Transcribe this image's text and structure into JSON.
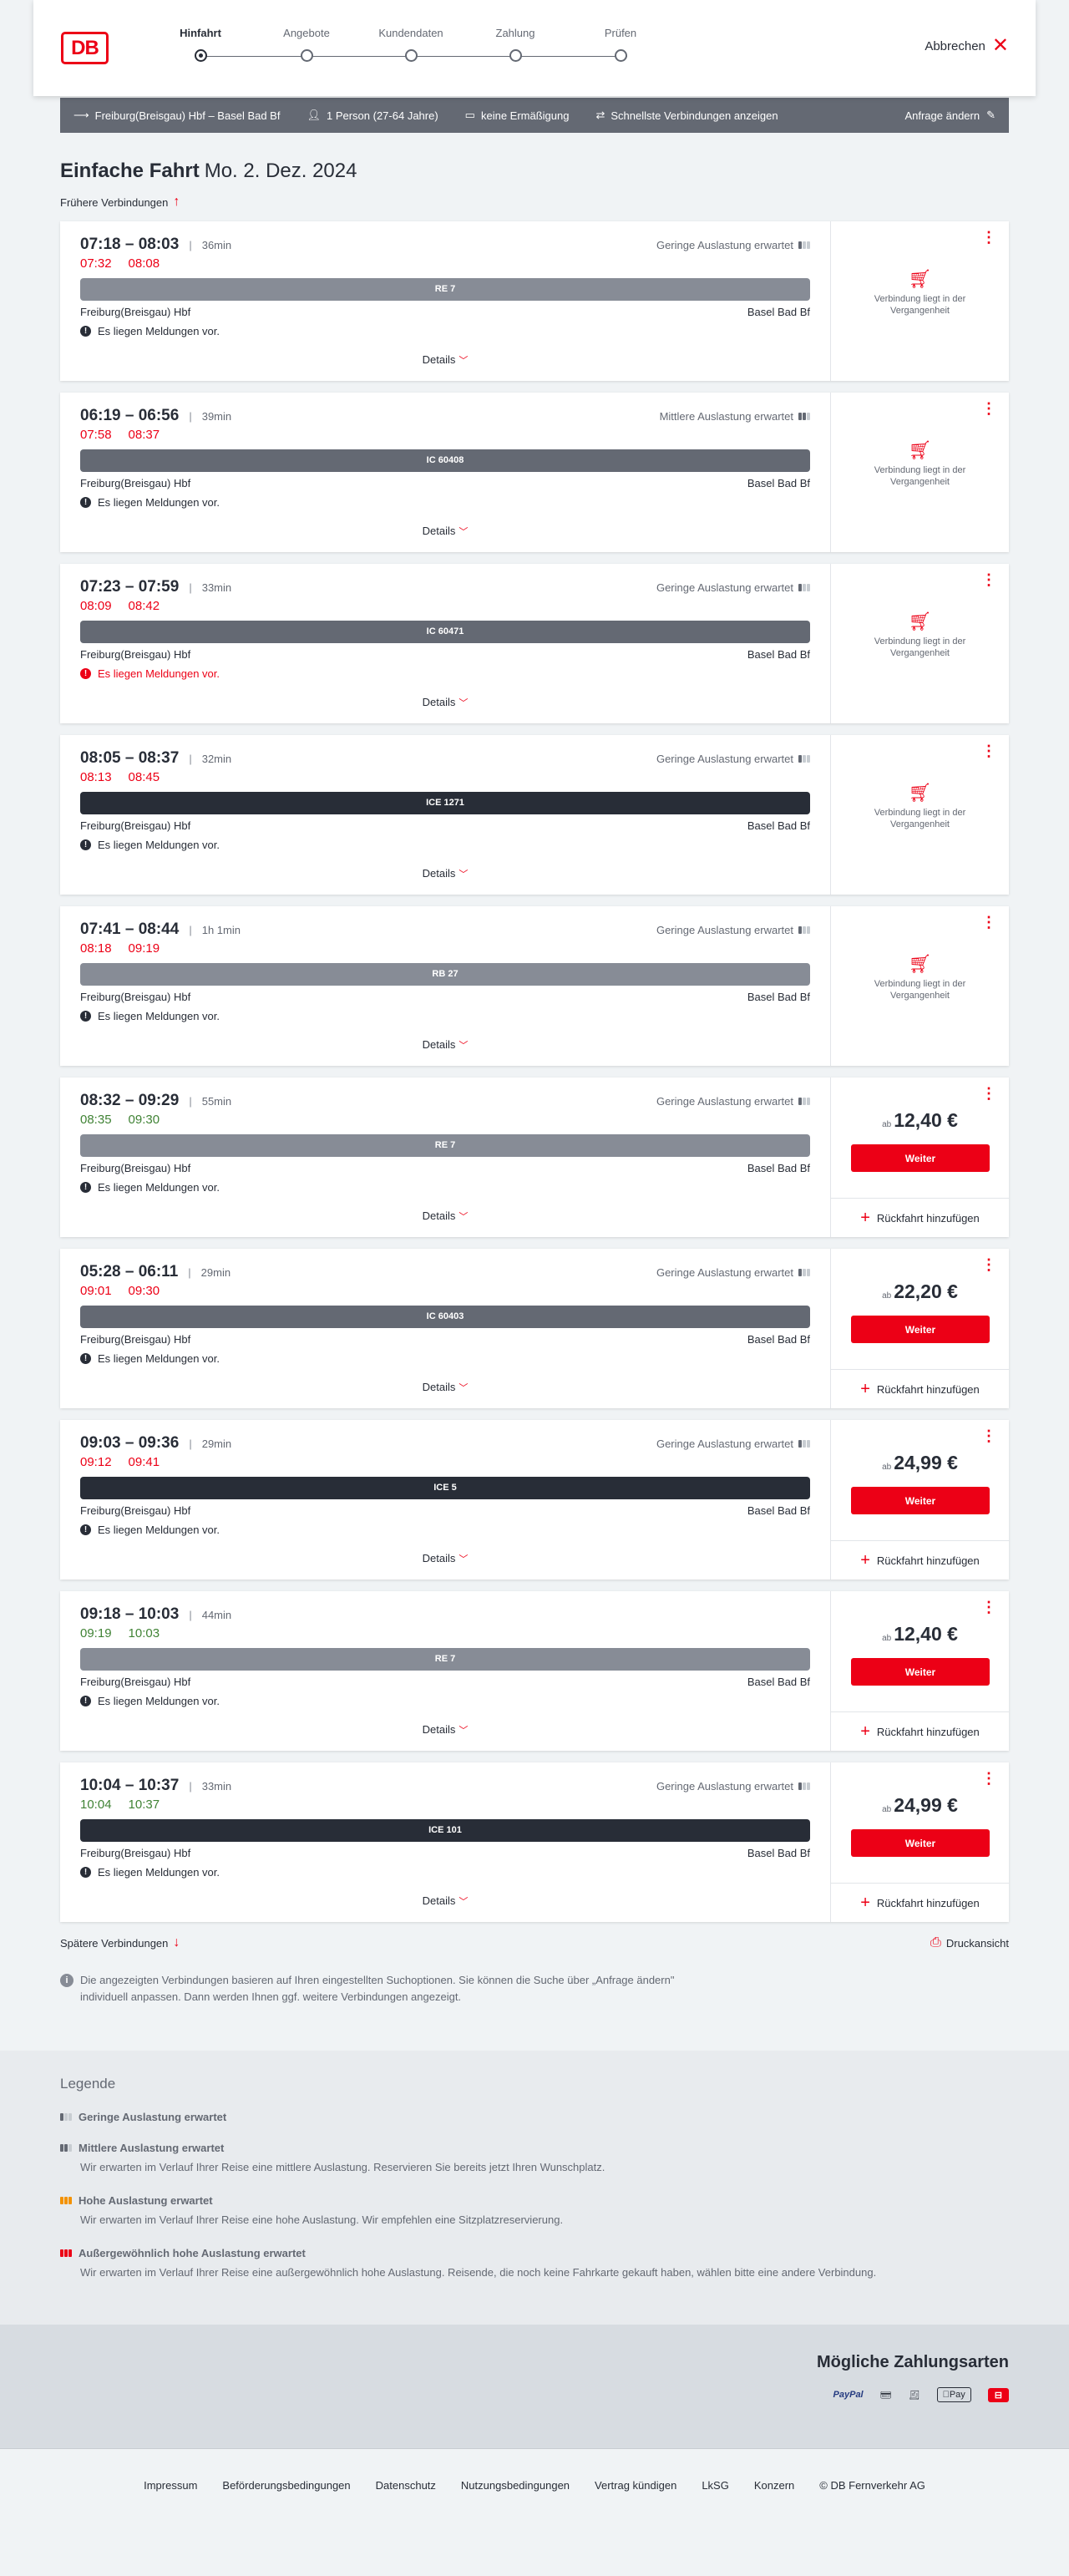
{
  "header": {
    "logo": "DB",
    "steps": [
      "Hinfahrt",
      "Angebote",
      "Kundendaten",
      "Zahlung",
      "Prüfen"
    ],
    "cancel": "Abbrechen"
  },
  "summary": {
    "route": "Freiburg(Breisgau) Hbf – Basel Bad Bf",
    "persons": "1 Person (27-64 Jahre)",
    "discount": "keine Ermäßigung",
    "fastest": "Schnellste Verbindungen anzeigen",
    "change": "Anfrage ändern"
  },
  "title": {
    "type": "Einfache Fahrt",
    "date": "Mo. 2. Dez. 2024"
  },
  "earlier": "Frühere Verbindungen",
  "labels": {
    "details": "Details",
    "past_line1": "Verbindung liegt in der",
    "past_line2": "Vergangenheit",
    "price_prefix": "ab",
    "continue": "Weiter",
    "add_return": "Rückfahrt hinzufügen"
  },
  "connections": [
    {
      "times": "07:18 – 08:03",
      "duration": "36min",
      "occupancy": "Geringe Auslastung erwartet",
      "occ_level": 1,
      "rt_dep": "07:32",
      "rt_arr": "08:08",
      "rt_status": "late",
      "train": "RE 7",
      "train_type": "re",
      "from": "Freiburg(Breisgau) Hbf",
      "to": "Basel Bad Bf",
      "message": "Es liegen Meldungen vor.",
      "message_warn": false,
      "past": true,
      "price": ""
    },
    {
      "times": "06:19 – 06:56",
      "duration": "39min",
      "occupancy": "Mittlere Auslastung erwartet",
      "occ_level": 2,
      "rt_dep": "07:58",
      "rt_arr": "08:37",
      "rt_status": "late",
      "train": "IC 60408",
      "train_type": "ic",
      "from": "Freiburg(Breisgau) Hbf",
      "to": "Basel Bad Bf",
      "message": "Es liegen Meldungen vor.",
      "message_warn": false,
      "past": true,
      "price": ""
    },
    {
      "times": "07:23 – 07:59",
      "duration": "33min",
      "occupancy": "Geringe Auslastung erwartet",
      "occ_level": 1,
      "rt_dep": "08:09",
      "rt_arr": "08:42",
      "rt_status": "late",
      "train": "IC 60471",
      "train_type": "ic",
      "from": "Freiburg(Breisgau) Hbf",
      "to": "Basel Bad Bf",
      "message": "Es liegen Meldungen vor.",
      "message_warn": true,
      "past": true,
      "price": ""
    },
    {
      "times": "08:05 – 08:37",
      "duration": "32min",
      "occupancy": "Geringe Auslastung erwartet",
      "occ_level": 1,
      "rt_dep": "08:13",
      "rt_arr": "08:45",
      "rt_status": "late",
      "train": "ICE 1271",
      "train_type": "ice",
      "from": "Freiburg(Breisgau) Hbf",
      "to": "Basel Bad Bf",
      "message": "Es liegen Meldungen vor.",
      "message_warn": false,
      "past": true,
      "price": ""
    },
    {
      "times": "07:41 – 08:44",
      "duration": "1h 1min",
      "occupancy": "Geringe Auslastung erwartet",
      "occ_level": 1,
      "rt_dep": "08:18",
      "rt_arr": "09:19",
      "rt_status": "late",
      "train": "RB 27",
      "train_type": "re",
      "from": "Freiburg(Breisgau) Hbf",
      "to": "Basel Bad Bf",
      "message": "Es liegen Meldungen vor.",
      "message_warn": false,
      "past": true,
      "price": ""
    },
    {
      "times": "08:32 – 09:29",
      "duration": "55min",
      "occupancy": "Geringe Auslastung erwartet",
      "occ_level": 1,
      "rt_dep": "08:35",
      "rt_arr": "09:30",
      "rt_status": "ok",
      "train": "RE 7",
      "train_type": "re",
      "from": "Freiburg(Breisgau) Hbf",
      "to": "Basel Bad Bf",
      "message": "Es liegen Meldungen vor.",
      "message_warn": false,
      "past": false,
      "price": "12,40 €"
    },
    {
      "times": "05:28 – 06:11",
      "duration": "29min",
      "occupancy": "Geringe Auslastung erwartet",
      "occ_level": 1,
      "rt_dep": "09:01",
      "rt_arr": "09:30",
      "rt_status": "late",
      "train": "IC 60403",
      "train_type": "ic",
      "from": "Freiburg(Breisgau) Hbf",
      "to": "Basel Bad Bf",
      "message": "Es liegen Meldungen vor.",
      "message_warn": false,
      "past": false,
      "price": "22,20 €"
    },
    {
      "times": "09:03 – 09:36",
      "duration": "29min",
      "occupancy": "Geringe Auslastung erwartet",
      "occ_level": 1,
      "rt_dep": "09:12",
      "rt_arr": "09:41",
      "rt_status": "late",
      "train": "ICE 5",
      "train_type": "ice",
      "from": "Freiburg(Breisgau) Hbf",
      "to": "Basel Bad Bf",
      "message": "Es liegen Meldungen vor.",
      "message_warn": false,
      "past": false,
      "price": "24,99 €"
    },
    {
      "times": "09:18 – 10:03",
      "duration": "44min",
      "occupancy": "",
      "occ_level": 0,
      "rt_dep": "09:19",
      "rt_arr": "10:03",
      "rt_status": "ok",
      "train": "RE 7",
      "train_type": "re",
      "from": "Freiburg(Breisgau) Hbf",
      "to": "Basel Bad Bf",
      "message": "Es liegen Meldungen vor.",
      "message_warn": false,
      "past": false,
      "price": "12,40 €"
    },
    {
      "times": "10:04 – 10:37",
      "duration": "33min",
      "occupancy": "Geringe Auslastung erwartet",
      "occ_level": 1,
      "rt_dep": "10:04",
      "rt_arr": "10:37",
      "rt_status": "ok",
      "train": "ICE 101",
      "train_type": "ice",
      "from": "Freiburg(Breisgau) Hbf",
      "to": "Basel Bad Bf",
      "message": "Es liegen Meldungen vor.",
      "message_warn": false,
      "past": false,
      "price": "24,99 €"
    }
  ],
  "later": "Spätere Verbindungen",
  "print": "Druckansicht",
  "info": "Die angezeigten Verbindungen basieren auf Ihren eingestellten Suchoptionen. Sie können die Suche über „Anfrage ändern\" individuell anpassen. Dann werden Ihnen ggf. weitere Verbindungen angezeigt.",
  "legend": {
    "title": "Legende",
    "items": [
      {
        "title": "Geringe Auslastung erwartet",
        "text": ""
      },
      {
        "title": "Mittlere Auslastung erwartet",
        "text": "Wir erwarten im Verlauf Ihrer Reise eine mittlere Auslastung. Reservieren Sie bereits jetzt Ihren Wunschplatz."
      },
      {
        "title": "Hohe Auslastung erwartet",
        "text": "Wir erwarten im Verlauf Ihrer Reise eine hohe Auslastung. Wir empfehlen eine Sitzplatzreservierung."
      },
      {
        "title": "Außergewöhnlich hohe Auslastung erwartet",
        "text": "Wir erwarten im Verlauf Ihrer Reise eine außergewöhnlich hohe Auslastung. Reisende, die noch keine Fahrkarte gekauft haben, wählen bitte eine andere Verbindung."
      }
    ]
  },
  "payment": {
    "title": "Mögliche Zahlungsarten",
    "paypal": "PayPal",
    "applepay": "Pay"
  },
  "footer": [
    "Impressum",
    "Beförderungsbedingungen",
    "Datenschutz",
    "Nutzungsbedingungen",
    "Vertrag kündigen",
    "LkSG",
    "Konzern",
    "© DB Fernverkehr AG"
  ],
  "colors": {
    "accent": "#ec0016",
    "late": "#ec0016",
    "ontime": "#408335"
  }
}
